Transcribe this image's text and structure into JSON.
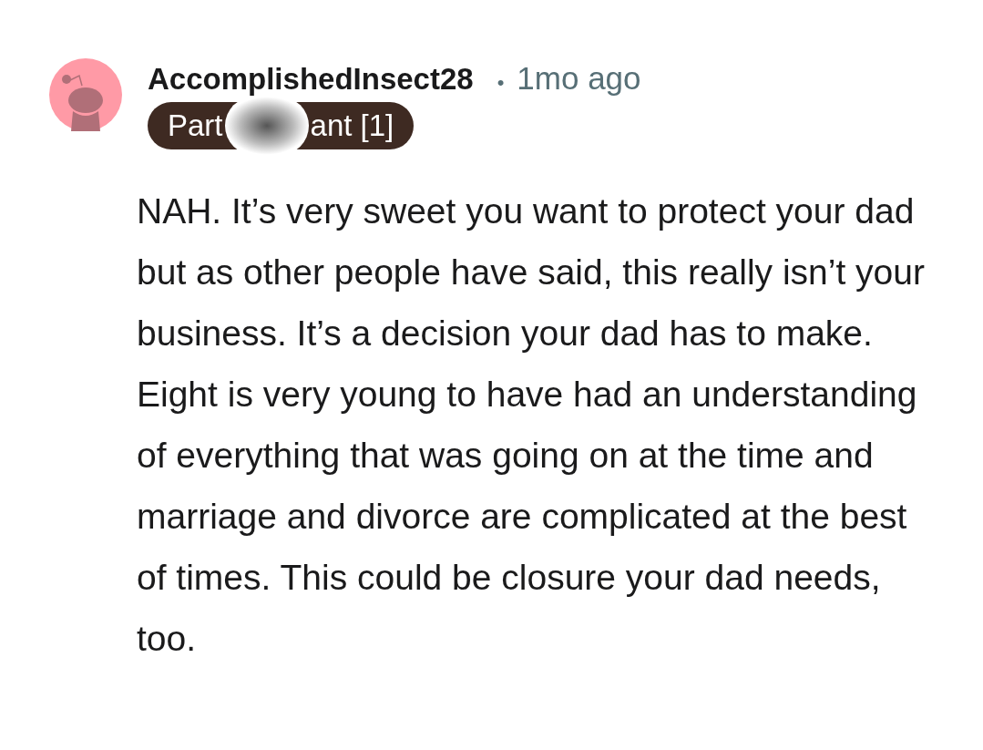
{
  "comment": {
    "username": "AccomplishedInsect28",
    "separator": "•",
    "time": "1mo ago",
    "flair": {
      "visible_start": "Part",
      "visible_end": "ant [1]",
      "redacted": true
    },
    "body": "NAH. It’s very sweet you want to protect your dad but as other people have said, this really isn’t your business. It’s a decision your dad has to make. Eight is very young to have had an understanding of everything that was going on at the time and marriage and divorce are complicated at the best of times. This could be closure your dad needs, too."
  }
}
